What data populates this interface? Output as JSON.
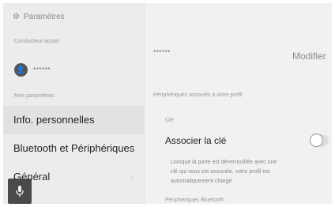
{
  "header": {
    "title": "Paramètres",
    "icon": "gear-icon"
  },
  "sidebar": {
    "current_driver_label": "Conducteur actuel",
    "current_driver_name": "******",
    "my_settings_label": "Mes paramètres",
    "items": [
      {
        "label": "Info. personnelles",
        "active": true
      },
      {
        "label": "Bluetooth et Périphériques",
        "active": false
      },
      {
        "label": "Général",
        "active": false
      }
    ]
  },
  "main": {
    "user_name": "******",
    "modify_label": "Modifier",
    "associated_devices_label": "Périphériques associés à votre profil",
    "key_section_label": "Clé",
    "associate_key_label": "Associer la clé",
    "associate_key_enabled": false,
    "description": "Lorsque la porte est déverrouillée avec une clé qui vous est associée, votre profil est automatiquement chargé.",
    "bluetooth_devices_label": "Périphériques Bluetooth"
  },
  "colors": {
    "background": "#f1f1f1",
    "sidebar": "#ececec",
    "active_item": "#e2e2e2",
    "mic_button": "#4a4a4a"
  }
}
